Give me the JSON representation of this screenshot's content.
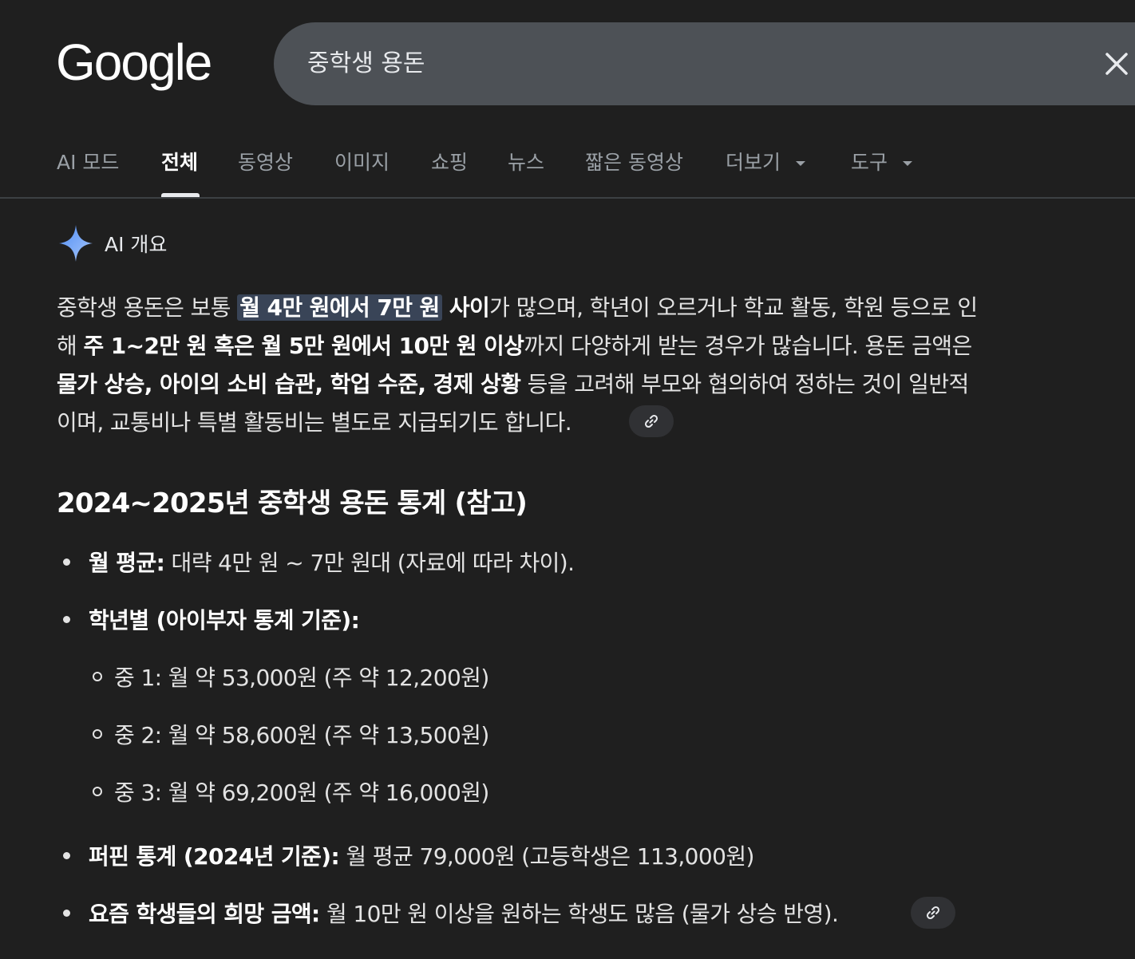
{
  "header": {
    "logo_text": "Google",
    "search_query": "중학생 용돈"
  },
  "tabs": [
    {
      "label": "AI 모드"
    },
    {
      "label": "전체",
      "active": true
    },
    {
      "label": "동영상"
    },
    {
      "label": "이미지"
    },
    {
      "label": "쇼핑"
    },
    {
      "label": "뉴스"
    },
    {
      "label": "짧은 동영상"
    },
    {
      "label": "더보기",
      "dropdown": true
    },
    {
      "label": "도구",
      "dropdown": true
    }
  ],
  "ai_overview": {
    "title": "AI 개요",
    "paragraph": {
      "line1": {
        "t1": "중학생 용돈은 보통 ",
        "highlight": "월 4만 원에서 7만 원",
        "b1": " 사이",
        "t2": "가 많으며, 학년이 오르거나 학교 활동, 학원 등으로 인"
      },
      "line2": {
        "t1": "해 ",
        "b1": "주 1~2만 원 혹은 월 5만 원에서 10만 원 이상",
        "t2": "까지 다양하게 받는 경우가 많습니다. 용돈 금액은"
      },
      "line3": {
        "b1": "물가 상승, 아이의 소비 습관, 학업 수준, 경제 상황",
        "t1": " 등을 고려해 부모와 협의하여 정하는 것이 일반적"
      },
      "line4": {
        "t1": "이며, 교통비나 특별 활동비는 별도로 지급되기도 합니다."
      }
    },
    "heading": "2024~2025년 중학생 용돈 통계 (참고)",
    "bullets": {
      "monthly_avg": {
        "label": "월 평균:",
        "text": " 대략 4만 원 ~ 7만 원대 (자료에 따라 차이)."
      },
      "by_grade": {
        "label": "학년별 (아이부자 통계 기준):"
      },
      "grades": [
        {
          "text": "중 1: 월 약 53,000원 (주 약 12,200원)"
        },
        {
          "text": "중 2: 월 약 58,600원 (주 약 13,500원)"
        },
        {
          "text": "중 3: 월 약 69,200원 (주 약 16,000원)"
        }
      ],
      "puffin": {
        "label": "퍼핀 통계 (2024년 기준):",
        "text": " 월 평균 79,000원 (고등학생은 113,000원)"
      },
      "wish": {
        "label": "요즘 학생들의 희망 금액:",
        "text": " 월 10만 원 이상을 원하는 학생도 많음 (물가 상승 반영)."
      }
    }
  },
  "colors": {
    "background": "#1f1f1f",
    "search_bg": "#4d5156",
    "highlight_bg": "#394457",
    "spark": "#8ab4f8",
    "chip_bg": "#303134"
  }
}
